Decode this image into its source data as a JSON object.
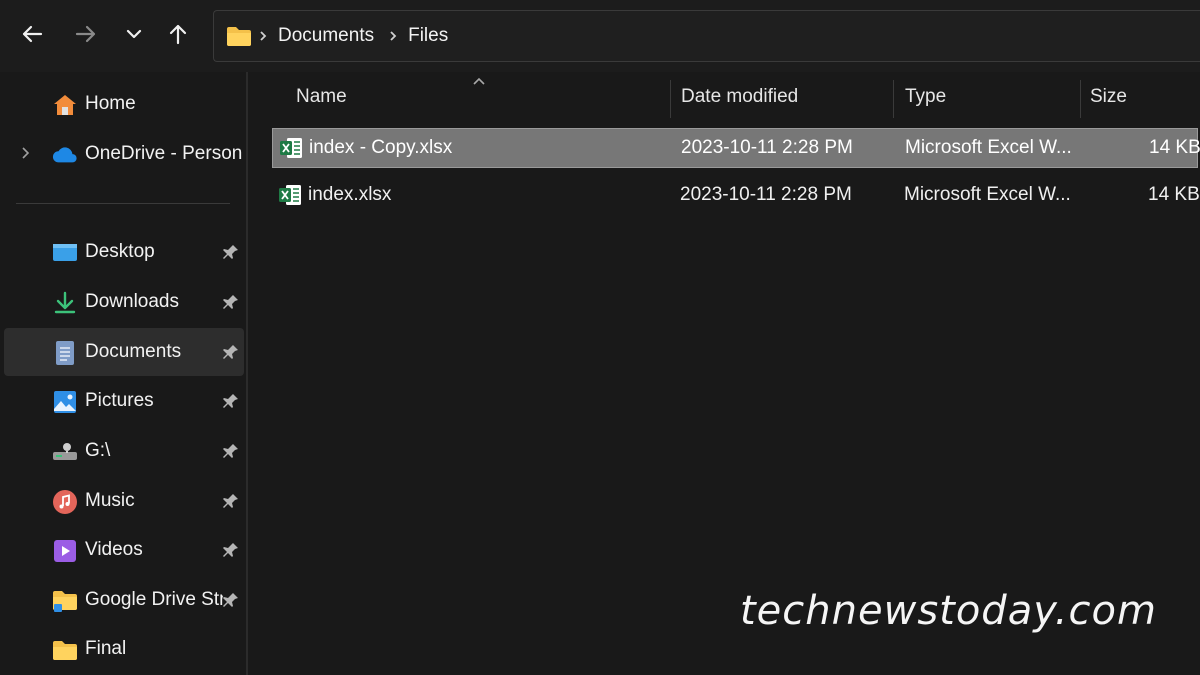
{
  "toolbar": {
    "back_icon": "arrow-left-icon",
    "forward_icon": "arrow-right-icon",
    "recent_icon": "chevron-down-icon",
    "up_icon": "arrow-up-icon"
  },
  "address": {
    "crumbs": [
      "Documents",
      "Files"
    ]
  },
  "sidebar": {
    "items": [
      {
        "label": "Home",
        "icon": "home-icon"
      },
      {
        "label": "OneDrive - Persona",
        "icon": "cloud-icon"
      },
      {
        "label": "Desktop",
        "icon": "desktop-icon",
        "pinned": true
      },
      {
        "label": "Downloads",
        "icon": "download-icon",
        "pinned": true
      },
      {
        "label": "Documents",
        "icon": "document-icon",
        "pinned": true,
        "selected": true
      },
      {
        "label": "Pictures",
        "icon": "picture-icon",
        "pinned": true
      },
      {
        "label": "G:\\",
        "icon": "drive-icon",
        "pinned": true
      },
      {
        "label": "Music",
        "icon": "music-icon",
        "pinned": true
      },
      {
        "label": "Videos",
        "icon": "video-icon",
        "pinned": true
      },
      {
        "label": "Google Drive Str",
        "icon": "folder-icon",
        "pinned": true
      },
      {
        "label": "Final",
        "icon": "folder-icon"
      }
    ]
  },
  "columns": {
    "name": "Name",
    "date": "Date modified",
    "type": "Type",
    "size": "Size"
  },
  "files": [
    {
      "name": "index - Copy.xlsx",
      "date": "2023-10-11 2:28 PM",
      "type": "Microsoft Excel W...",
      "size": "14 KB",
      "selected": true
    },
    {
      "name": "index.xlsx",
      "date": "2023-10-11 2:28 PM",
      "type": "Microsoft Excel W...",
      "size": "14 KB"
    }
  ],
  "watermark": "technewstoday.com",
  "colors": {
    "background": "#191919",
    "selected_row": "#777777",
    "folder": "#f4c14a",
    "excel": "#1f7a45"
  }
}
